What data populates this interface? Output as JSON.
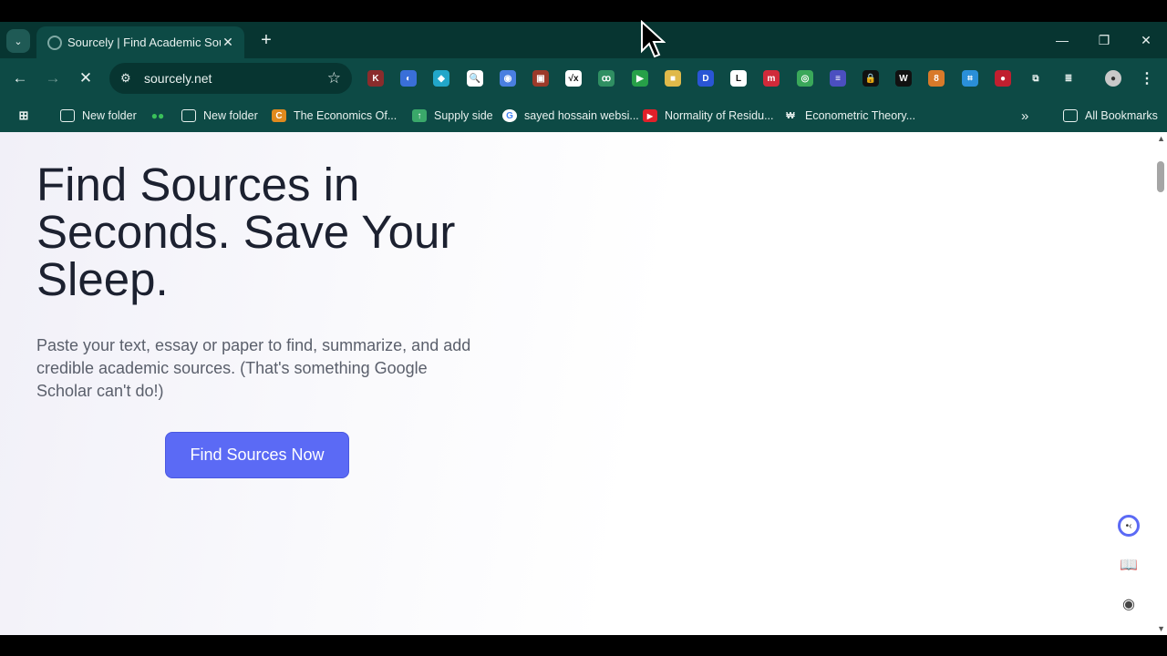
{
  "browser": {
    "tab_title": "Sourcely | Find Academic Sources",
    "tab_close": "✕",
    "new_tab": "+",
    "window_controls": {
      "minimize": "—",
      "restore": "❐",
      "close": "✕"
    },
    "url": "sourcely.net",
    "nav": {
      "back": "←",
      "forward": "→",
      "stop": "✕"
    },
    "extensions": [
      {
        "label": "K",
        "color": "#8a2c2c"
      },
      {
        "label": "◐",
        "color": "#3a6fd8"
      },
      {
        "label": "◆",
        "color": "#22a6c9"
      },
      {
        "label": "🔍",
        "color": "#ffffff"
      },
      {
        "label": "◉",
        "color": "#4a7fe0"
      },
      {
        "label": "▣",
        "color": "#9c3a2a"
      },
      {
        "label": "√x",
        "color": "#ffffff"
      },
      {
        "label": "ꝏ",
        "color": "#2f8f62"
      },
      {
        "label": "▶",
        "color": "#27a048"
      },
      {
        "label": "■",
        "color": "#e0b94a"
      },
      {
        "label": "D",
        "color": "#2a55d5"
      },
      {
        "label": "L",
        "color": "#ffffff"
      },
      {
        "label": "m",
        "color": "#d02a3a"
      },
      {
        "label": "◎",
        "color": "#3aa85a"
      },
      {
        "label": "≡",
        "color": "#4b4fc0"
      },
      {
        "label": "🔒",
        "color": "#111111"
      },
      {
        "label": "W",
        "color": "#111111"
      },
      {
        "label": "8",
        "color": "#d87a2a"
      },
      {
        "label": "⌗",
        "color": "#2a8fd8"
      },
      {
        "label": "●",
        "color": "#c01f2f"
      },
      {
        "label": "⧉",
        "color": "#e8f1ef"
      },
      {
        "label": "≣",
        "color": "#e8f1ef"
      }
    ],
    "bookmarks": [
      {
        "label": "",
        "icon": "apps-grid-icon"
      },
      {
        "label": "New folder",
        "icon": "folder-icon"
      },
      {
        "label": "",
        "icon": "wechat-icon"
      },
      {
        "label": "New folder",
        "icon": "folder-icon"
      },
      {
        "label": "The Economics Of...",
        "icon": "c-icon"
      },
      {
        "label": "Supply side",
        "icon": "supply-icon"
      },
      {
        "label": "sayed hossain websi...",
        "icon": "google-icon"
      },
      {
        "label": "Normality of Residu...",
        "icon": "youtube-icon"
      },
      {
        "label": "Econometric Theory...",
        "icon": "lines-icon"
      }
    ],
    "bookmarks_overflow": "»",
    "all_bookmarks": "All Bookmarks"
  },
  "page": {
    "title": "Find Sources in Seconds. Save Your Sleep.",
    "subtitle": "Paste your text, essay or paper to find, summarize, and add credible academic sources. (That's something Google Scholar can't do!)",
    "cta": "Find Sources Now",
    "accent_color": "#5b6af5"
  }
}
